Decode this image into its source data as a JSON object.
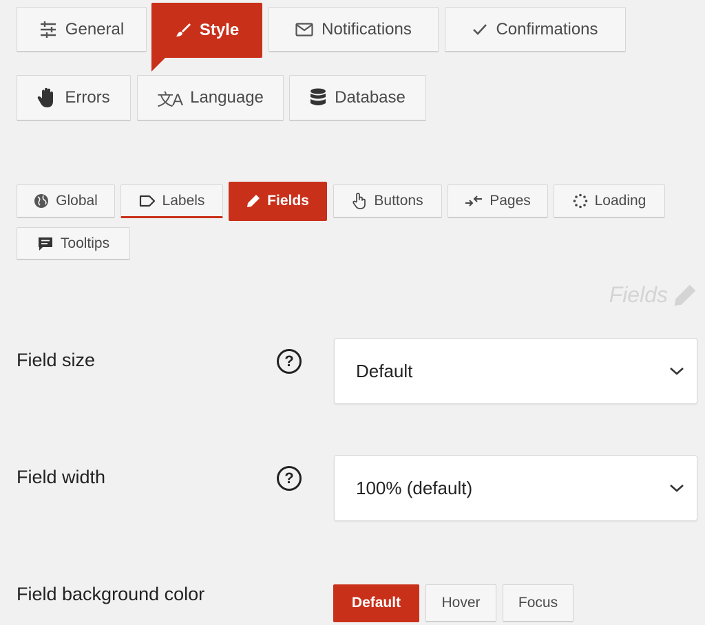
{
  "main_tabs": [
    {
      "label": "General",
      "icon": "sliders-icon"
    },
    {
      "label": "Style",
      "icon": "paintbrush-icon"
    },
    {
      "label": "Notifications",
      "icon": "envelope-icon"
    },
    {
      "label": "Confirmations",
      "icon": "checkmark-icon"
    },
    {
      "label": "Errors",
      "icon": "hand-icon"
    },
    {
      "label": "Language",
      "icon": "translate-icon"
    },
    {
      "label": "Database",
      "icon": "database-icon"
    }
  ],
  "sub_tabs": [
    {
      "label": "Global",
      "icon": "globe-icon"
    },
    {
      "label": "Labels",
      "icon": "tag-icon"
    },
    {
      "label": "Fields",
      "icon": "pencil-icon"
    },
    {
      "label": "Buttons",
      "icon": "pointer-hand-icon"
    },
    {
      "label": "Pages",
      "icon": "arrows-icon"
    },
    {
      "label": "Loading",
      "icon": "spinner-icon"
    },
    {
      "label": "Tooltips",
      "icon": "comment-icon"
    }
  ],
  "section": {
    "title": "Fields"
  },
  "settings": {
    "field_size": {
      "label": "Field size",
      "help": "?",
      "value": "Default"
    },
    "field_width": {
      "label": "Field width",
      "help": "?",
      "value": "100% (default)"
    },
    "field_bg": {
      "label": "Field background color",
      "states": [
        "Default",
        "Hover",
        "Focus"
      ]
    }
  },
  "colors": {
    "accent": "#c9301a",
    "background": "#f1f1f1"
  }
}
